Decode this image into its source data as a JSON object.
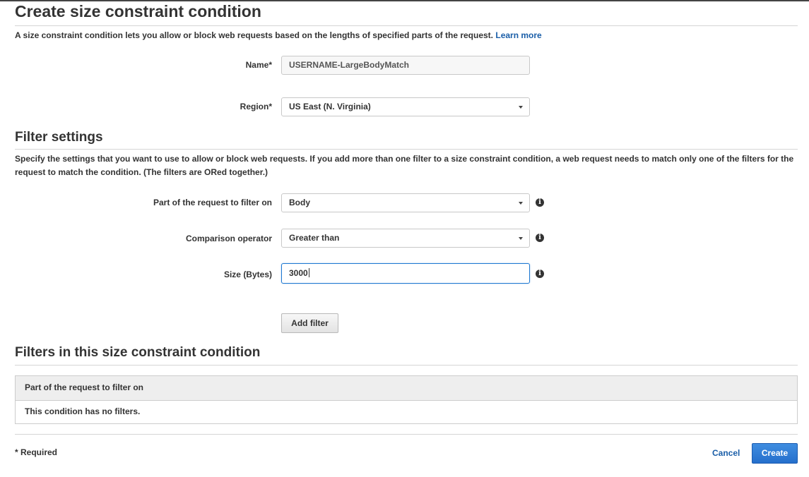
{
  "page": {
    "title": "Create size constraint condition",
    "description": "A size constraint condition lets you allow or block web requests based on the lengths of specified parts of the request.",
    "learn_more": "Learn more"
  },
  "form": {
    "name": {
      "label": "Name*",
      "value": "USERNAME-LargeBodyMatch"
    },
    "region": {
      "label": "Region*",
      "value": "US East (N. Virginia)"
    }
  },
  "filter_settings": {
    "title": "Filter settings",
    "description": "Specify the settings that you want to use to allow or block web requests. If you add more than one filter to a size constraint condition, a web request needs to match only one of the filters for the request to match the condition. (The filters are ORed together.)",
    "part": {
      "label": "Part of the request to filter on",
      "value": "Body"
    },
    "operator": {
      "label": "Comparison operator",
      "value": "Greater than"
    },
    "size": {
      "label": "Size (Bytes)",
      "value": "3000"
    },
    "info_icon": "i",
    "add_filter": "Add filter"
  },
  "filters_table": {
    "title": "Filters in this size constraint condition",
    "columns": [
      "Part of the request to filter on"
    ],
    "empty_message": "This condition has no filters."
  },
  "footer": {
    "required_note": "* Required",
    "cancel": "Cancel",
    "create": "Create"
  },
  "icons": {
    "info": "info-circle-icon",
    "dropdown": "caret-down-icon"
  },
  "colors": {
    "link": "#1a5ea8",
    "primary": "#2f7ad6",
    "focus": "#1f78d1"
  }
}
